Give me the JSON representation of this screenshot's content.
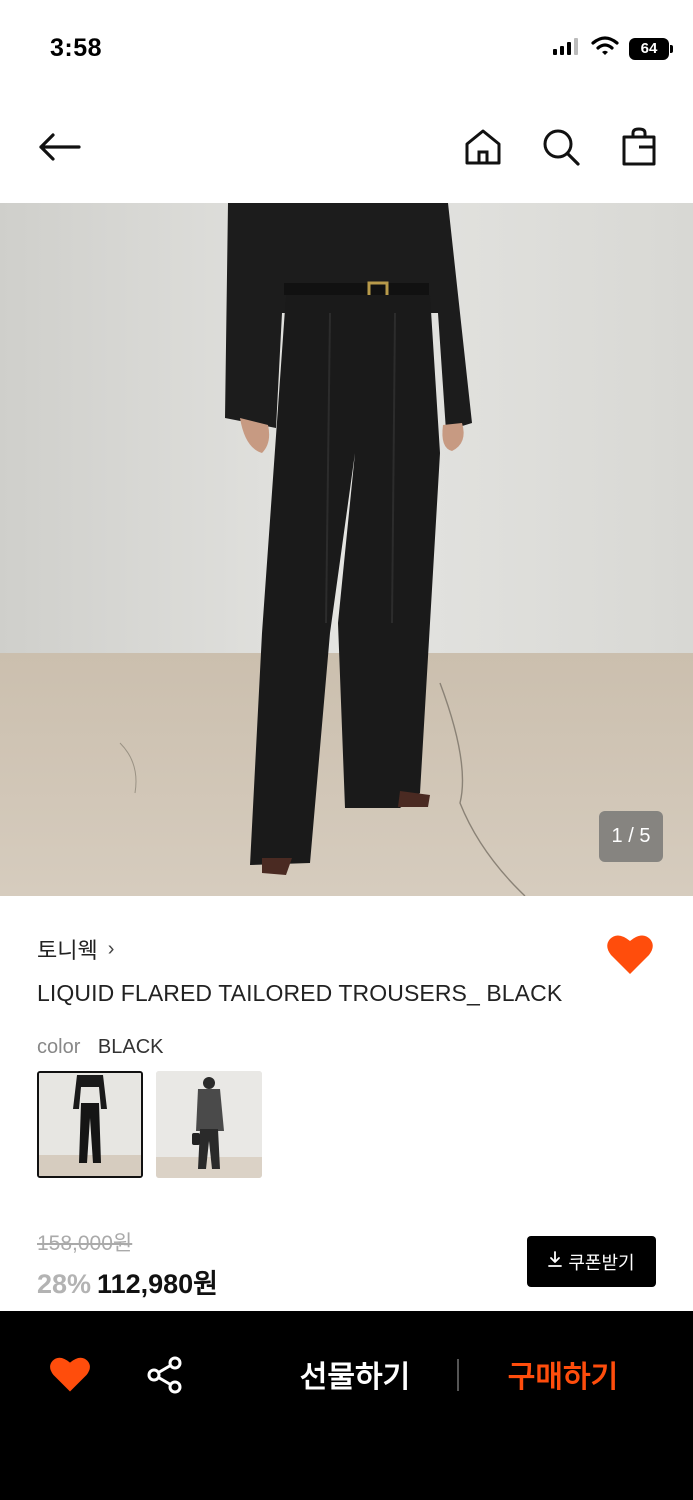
{
  "status_bar": {
    "time": "3:58",
    "battery": "64"
  },
  "header": {
    "back_icon": "arrow-left-icon",
    "home_icon": "home-icon",
    "search_icon": "search-icon",
    "bag_icon": "shopping-bag-icon"
  },
  "gallery": {
    "counter": "1 / 5",
    "current": 1,
    "total": 5
  },
  "product": {
    "brand": "토니웩",
    "brand_chevron": "›",
    "name": "LIQUID FLARED TAILORED TROUSERS_ BLACK",
    "wishlisted": true,
    "color_label": "color",
    "color_value": "BLACK",
    "swatches": [
      {
        "selected": true
      },
      {
        "selected": false
      }
    ]
  },
  "price": {
    "original": "158,000원",
    "discount": "28%",
    "sale": "112,980원",
    "coupon_label": "쿠폰받기"
  },
  "bottom_bar": {
    "gift_label": "선물하기",
    "buy_label": "구매하기",
    "heart_icon": "heart-icon",
    "share_icon": "share-icon"
  },
  "colors": {
    "accent": "#ff4d0c",
    "heart": "#ff4d0c",
    "bottom_bar_bg": "#000000",
    "coupon_bg": "#000000"
  }
}
